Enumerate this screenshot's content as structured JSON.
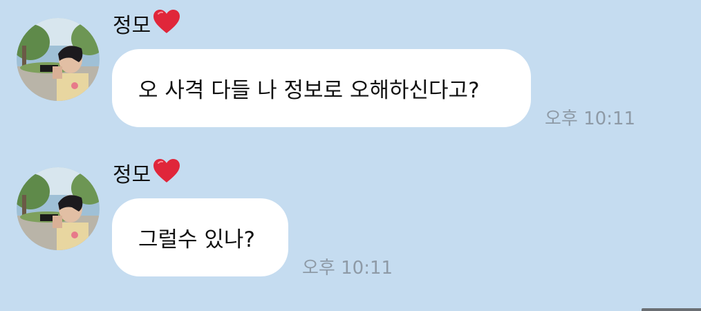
{
  "messages": [
    {
      "sender": "정모",
      "sender_emoji": "heart",
      "text": "오 사격 다들 나 정보로 오해하신다고?",
      "time": "오후 10:11"
    },
    {
      "sender": "정모",
      "sender_emoji": "heart",
      "text": "그럴수 있나?",
      "time": "오후 10:11"
    }
  ],
  "colors": {
    "background": "#c5dcf0",
    "bubble": "#ffffff",
    "time_text": "#8e9aa6",
    "heart": "#e0263a"
  }
}
